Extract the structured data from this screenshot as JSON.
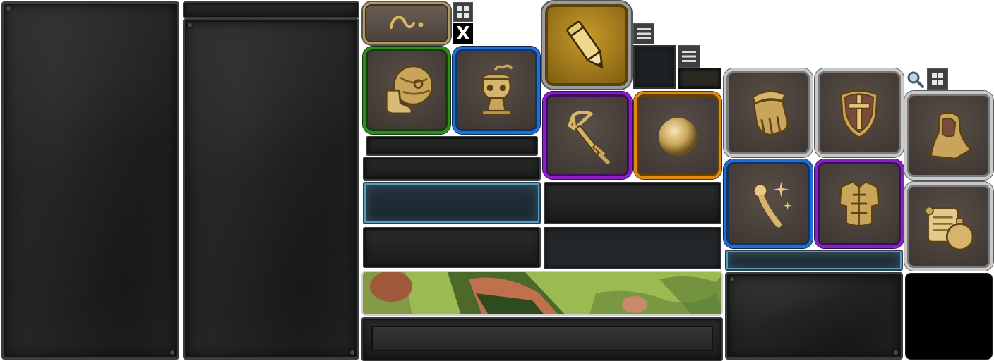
{
  "close_label": "X",
  "icons": {
    "map_tab": "squiggle-icon",
    "grid": "grid-icon",
    "menu": "menu-icon",
    "search": "magnifier-icon",
    "pencil": "pencil-icon"
  },
  "tiles": [
    {
      "name": "boots-shield-icon",
      "rarity": "green"
    },
    {
      "name": "urn-icon",
      "rarity": "blue"
    },
    {
      "name": "bow-sword-icon",
      "rarity": "purple"
    },
    {
      "name": "orb-icon",
      "rarity": "orange"
    },
    {
      "name": "gauntlet-icon",
      "rarity": "silver"
    },
    {
      "name": "shield-dagger-icon",
      "rarity": "silver"
    },
    {
      "name": "hood-cape-icon",
      "rarity": "silver"
    },
    {
      "name": "magic-staff-icon",
      "rarity": "blue"
    },
    {
      "name": "armor-chest-icon",
      "rarity": "purple"
    },
    {
      "name": "scroll-potion-icon",
      "rarity": "silver"
    }
  ],
  "colors": {
    "green": "#2e8c1e",
    "blue": "#1f6fd8",
    "purple": "#8a1fc9",
    "orange": "#e08a0e",
    "silver": "#c9c9c9",
    "gold": "#c89a2a",
    "panel": "#232526"
  }
}
